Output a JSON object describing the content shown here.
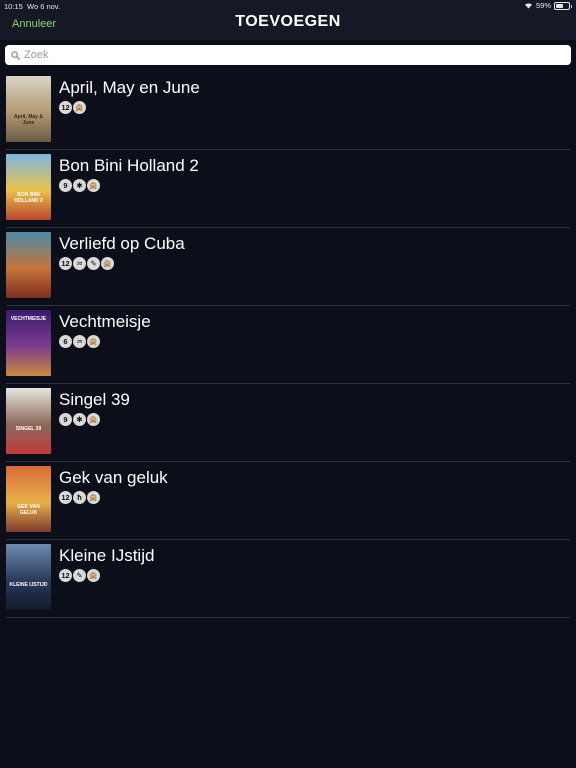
{
  "status": {
    "time": "10:15",
    "date": "Wo 6 nov.",
    "battery": "59%",
    "battery_level": 0.59
  },
  "header": {
    "cancel_label": "Annuleer",
    "title": "TOEVOEGEN"
  },
  "search": {
    "placeholder": "Zoek"
  },
  "movies": [
    {
      "title": "April, May en June",
      "poster_text": "April, May & June",
      "poster_colors": [
        "#d9d4c6",
        "#b39a72",
        "#6a5a44"
      ],
      "ratings": [
        "12",
        "🙊"
      ]
    },
    {
      "title": "Bon Bini Holland 2",
      "poster_text": "BON BINI HOLLAND 2",
      "poster_colors": [
        "#7db6e0",
        "#e9c24b",
        "#b8452d"
      ],
      "ratings": [
        "9",
        "✱",
        "🙊"
      ]
    },
    {
      "title": "Verliefd op Cuba",
      "poster_text": "",
      "poster_colors": [
        "#4a8aa8",
        "#c7743a",
        "#7a2e1e"
      ],
      "ratings": [
        "12",
        "♒",
        "✎",
        "🙊"
      ]
    },
    {
      "title": "Vechtmeisje",
      "poster_text": "VECHTMEISJE",
      "poster_colors": [
        "#3c1a6e",
        "#7a3c8e",
        "#c98a3a"
      ],
      "ratings": [
        "6",
        "♒",
        "🙊"
      ]
    },
    {
      "title": "Singel 39",
      "poster_text": "SINGEL 39",
      "poster_colors": [
        "#e8e4e0",
        "#8a6a5a",
        "#c23a3a"
      ],
      "ratings": [
        "9",
        "✱",
        "🙊"
      ]
    },
    {
      "title": "Gek van geluk",
      "poster_text": "GEK VAN GELUK",
      "poster_colors": [
        "#d96a3a",
        "#e8b04a",
        "#7a3a2a"
      ],
      "ratings": [
        "12",
        "ħ",
        "🙊"
      ]
    },
    {
      "title": "Kleine IJstijd",
      "poster_text": "KLEINE IJSTIJD",
      "poster_colors": [
        "#6e8ab0",
        "#2a3a5a",
        "#121a2a"
      ],
      "ratings": [
        "12",
        "✎",
        "🙊"
      ]
    }
  ]
}
